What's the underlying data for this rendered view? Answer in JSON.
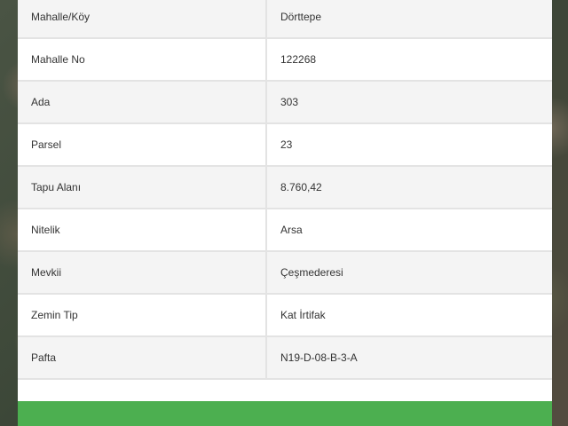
{
  "rows": [
    {
      "label": "Mahalle/Köy",
      "value": "Dörttepe"
    },
    {
      "label": "Mahalle No",
      "value": "122268"
    },
    {
      "label": "Ada",
      "value": "303"
    },
    {
      "label": "Parsel",
      "value": "23"
    },
    {
      "label": "Tapu Alanı",
      "value": "8.760,42"
    },
    {
      "label": "Nitelik",
      "value": "Arsa"
    },
    {
      "label": "Mevkii",
      "value": "Çeşmederesi"
    },
    {
      "label": "Zemin Tip",
      "value": "Kat İrtifak"
    },
    {
      "label": "Pafta",
      "value": "N19-D-08-B-3-A"
    }
  ],
  "colors": {
    "button": "#4caf50",
    "row_alt": "#f4f4f4",
    "border": "#e3e3e3"
  }
}
